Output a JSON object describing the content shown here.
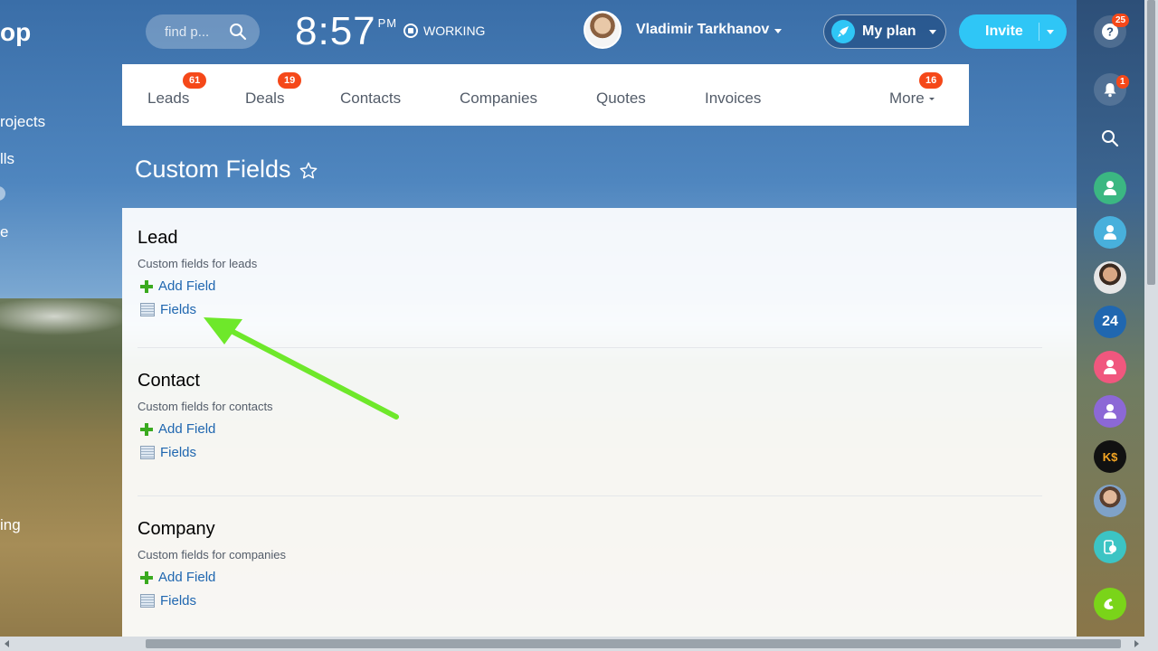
{
  "sidebar": {
    "logo_fragment": "op",
    "items": [
      "rojects",
      "lls",
      "e",
      "ing"
    ]
  },
  "header": {
    "search_placeholder": "find p...",
    "time": "8:57",
    "ampm": "PM",
    "status": "WORKING",
    "user_name": "Vladimir Tarkhanov",
    "my_plan": "My plan",
    "invite": "Invite"
  },
  "tabs": [
    {
      "label": "Leads",
      "badge": "61"
    },
    {
      "label": "Deals",
      "badge": "19"
    },
    {
      "label": "Contacts",
      "badge": ""
    },
    {
      "label": "Companies",
      "badge": ""
    },
    {
      "label": "Quotes",
      "badge": ""
    },
    {
      "label": "Invoices",
      "badge": ""
    },
    {
      "label": "More",
      "badge": "16"
    }
  ],
  "page": {
    "title": "Custom Fields"
  },
  "sections": [
    {
      "title": "Lead",
      "desc": "Custom fields for leads",
      "add": "Add Field",
      "fields": "Fields"
    },
    {
      "title": "Contact",
      "desc": "Custom fields for contacts",
      "add": "Add Field",
      "fields": "Fields"
    },
    {
      "title": "Company",
      "desc": "Custom fields for companies",
      "add": "Add Field",
      "fields": "Fields"
    }
  ],
  "right_panel": {
    "help_badge": "25",
    "notifications_badge": "1",
    "b24_label": "24",
    "ks_label": "K$"
  },
  "colors": {
    "accent": "#2fc6f6",
    "badge": "#f54819",
    "link": "#2067b0",
    "plus": "#3aaa1f",
    "arrow": "#6ee82a"
  }
}
